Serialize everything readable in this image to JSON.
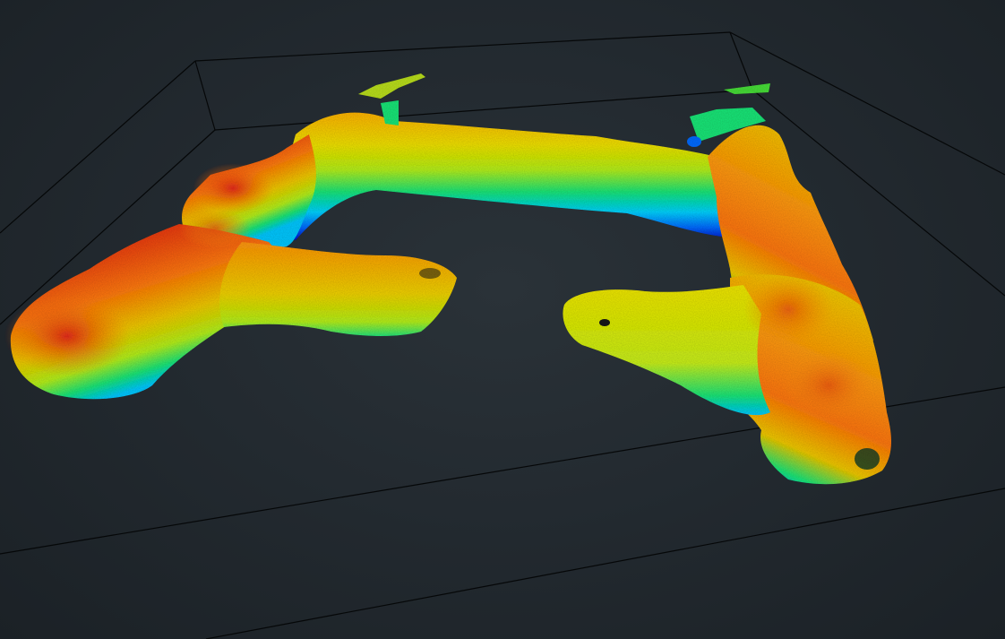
{
  "scene": {
    "background_color": "#232a30",
    "bounding_box_color": "#050708",
    "colormap": [
      "#0a14c8",
      "#0f6cff",
      "#00d2ff",
      "#1ee678",
      "#b4f01e",
      "#f0e100",
      "#ffb400",
      "#ff7814",
      "#e63219"
    ],
    "colormap_encodes": "elevation",
    "shape": "U-shaped corridor point cloud",
    "view": "perspective 3D"
  }
}
